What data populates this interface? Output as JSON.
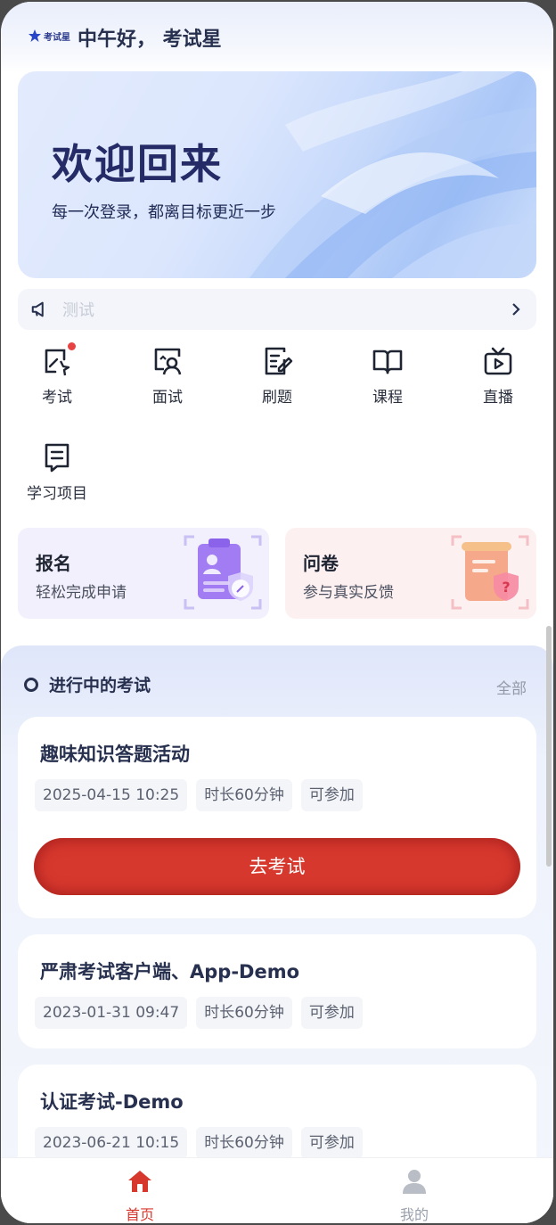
{
  "header": {
    "logo_text": "考试星",
    "greeting": "中午好， 考试星"
  },
  "banner": {
    "title": "欢迎回来",
    "subtitle": "每一次登录，都离目标更近一步"
  },
  "notice": {
    "text": "测试"
  },
  "grid": [
    {
      "label": "考试",
      "icon": "exam-icon",
      "badge": true
    },
    {
      "label": "面试",
      "icon": "interview-icon"
    },
    {
      "label": "刷题",
      "icon": "practice-icon"
    },
    {
      "label": "课程",
      "icon": "course-icon"
    },
    {
      "label": "直播",
      "icon": "live-icon"
    },
    {
      "label": "学习项目",
      "icon": "study-project-icon"
    }
  ],
  "cards": {
    "signup": {
      "title": "报名",
      "subtitle": "轻松完成申请"
    },
    "survey": {
      "title": "问卷",
      "subtitle": "参与真实反馈"
    }
  },
  "section": {
    "title": "进行中的考试",
    "all_label": "全部"
  },
  "exams": [
    {
      "name": "趣味知识答题活动",
      "date": "2025-04-15 10:25",
      "duration": "时长60分钟",
      "status": "可参加",
      "button": "去考试"
    },
    {
      "name": "严肃考试客户端、App-Demo",
      "date": "2023-01-31 09:47",
      "duration": "时长60分钟",
      "status": "可参加"
    },
    {
      "name": "认证考试-Demo",
      "date": "2023-06-21 10:15",
      "duration": "时长60分钟",
      "status": "可参加"
    }
  ],
  "tabbar": [
    {
      "label": "首页",
      "icon": "home-icon",
      "active": true
    },
    {
      "label": "我的",
      "icon": "user-icon",
      "active": false
    }
  ],
  "colors": {
    "accent_red": "#d7382e",
    "title_navy": "#27314f",
    "tab_active": "#d7382e",
    "tab_inactive": "#9aa0ac"
  }
}
